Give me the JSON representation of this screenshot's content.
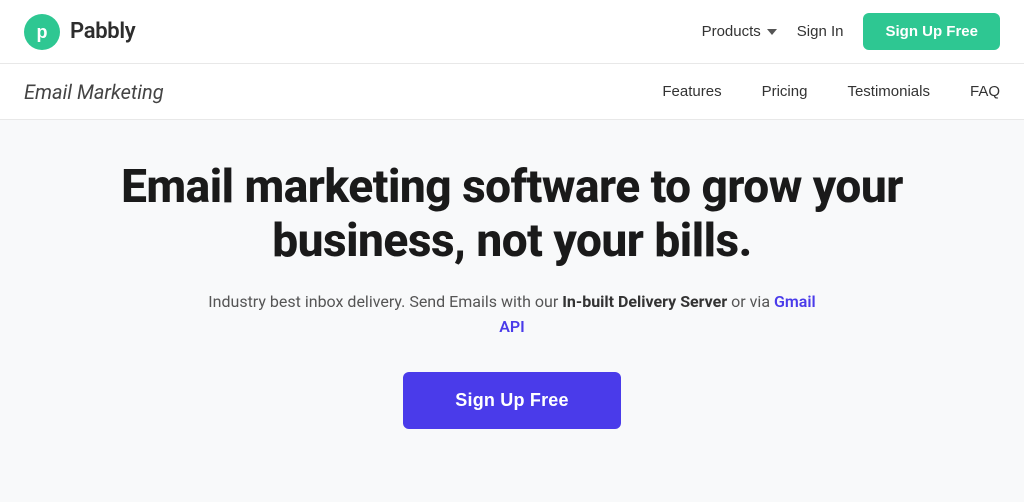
{
  "topnav": {
    "logo_text": "Pabbly",
    "products_label": "Products",
    "signin_label": "Sign In",
    "signup_label": "Sign Up Free"
  },
  "subnav": {
    "title": "Email Marketing",
    "links": [
      {
        "label": "Features"
      },
      {
        "label": "Pricing"
      },
      {
        "label": "Testimonials"
      },
      {
        "label": "FAQ"
      }
    ]
  },
  "hero": {
    "headline": "Email marketing software to grow your business, not your bills.",
    "subtext_prefix": "Industry best inbox delivery. Send Emails with our ",
    "subtext_bold": "In-built Delivery Server",
    "subtext_middle": " or via ",
    "subtext_link": "Gmail API",
    "signup_label": "Sign Up Free"
  },
  "colors": {
    "green": "#2ec792",
    "purple": "#4a3bea",
    "gmail_link": "#4a3bea"
  }
}
